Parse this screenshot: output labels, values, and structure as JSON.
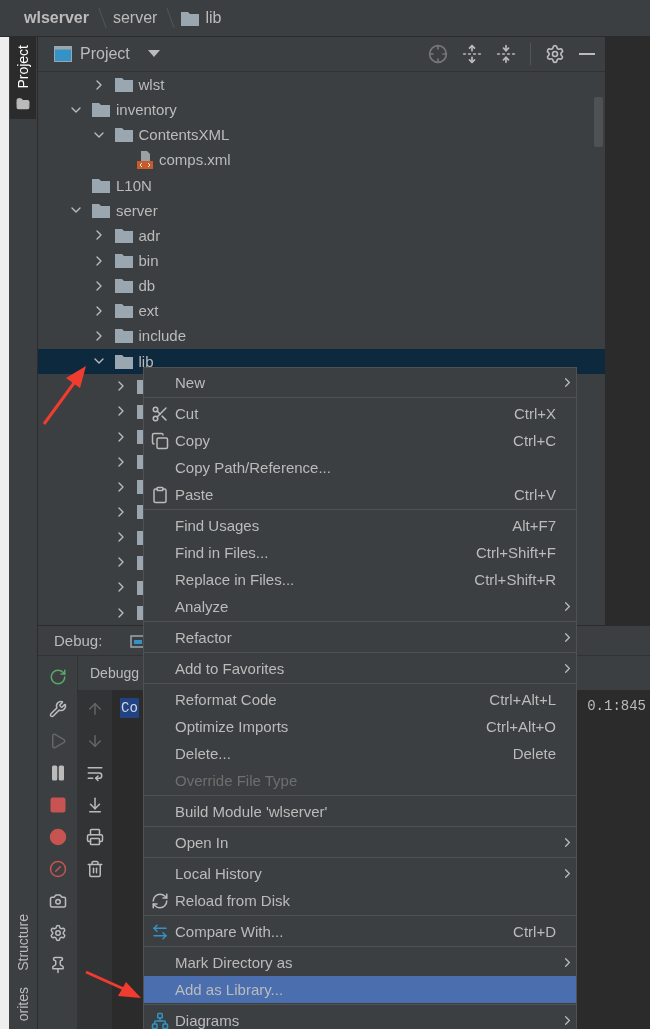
{
  "breadcrumb": [
    "wlserver",
    "server",
    "lib"
  ],
  "side_tabs": {
    "top": "Project",
    "bottom": [
      "Structure",
      "orites"
    ]
  },
  "project_panel": {
    "title": "Project"
  },
  "tree": {
    "scrolled_rows": [
      {
        "name": "wlst",
        "expanded": false,
        "selected": false
      }
    ],
    "items": [
      {
        "name": "inventory",
        "expanded": true,
        "selected": false,
        "children": [
          {
            "name": "ContentsXML",
            "expanded": true,
            "selected": false,
            "children": [
              {
                "name": "comps.xml",
                "kind": "file",
                "selected": false
              }
            ]
          }
        ]
      },
      {
        "name": "L10N",
        "selected": false
      },
      {
        "name": "server",
        "expanded": true,
        "selected": false,
        "children": [
          {
            "name": "adr",
            "expanded": false,
            "selected": false
          },
          {
            "name": "bin",
            "expanded": false,
            "selected": false
          },
          {
            "name": "db",
            "expanded": false,
            "selected": false
          },
          {
            "name": "ext",
            "expanded": false,
            "selected": false
          },
          {
            "name": "include",
            "expanded": false,
            "selected": false
          },
          {
            "name": "lib",
            "expanded": true,
            "selected": true
          }
        ]
      }
    ]
  },
  "debug": {
    "label": "Debug:",
    "tab": "Debugg",
    "console_highlight": "Co",
    "console_text": "0.1:845"
  },
  "context_menu": [
    [
      {
        "label": "New",
        "submenu": true
      }
    ],
    [
      {
        "label": "Cut",
        "shortcut": "Ctrl+X"
      },
      {
        "label": "Copy",
        "shortcut": "Ctrl+C"
      },
      {
        "label": "Copy Path/Reference..."
      },
      {
        "label": "Paste",
        "shortcut": "Ctrl+V"
      }
    ],
    [
      {
        "label": "Find Usages",
        "shortcut": "Alt+F7"
      },
      {
        "label": "Find in Files...",
        "shortcut": "Ctrl+Shift+F"
      },
      {
        "label": "Replace in Files...",
        "shortcut": "Ctrl+Shift+R"
      },
      {
        "label": "Analyze",
        "submenu": true
      }
    ],
    [
      {
        "label": "Refactor",
        "submenu": true
      }
    ],
    [
      {
        "label": "Add to Favorites",
        "submenu": true
      }
    ],
    [
      {
        "label": "Reformat Code",
        "shortcut": "Ctrl+Alt+L"
      },
      {
        "label": "Optimize Imports",
        "shortcut": "Ctrl+Alt+O"
      },
      {
        "label": "Delete...",
        "shortcut": "Delete"
      },
      {
        "label": "Override File Type",
        "disabled": true
      }
    ],
    [
      {
        "label": "Build Module 'wlserver'"
      }
    ],
    [
      {
        "label": "Open In",
        "submenu": true
      }
    ],
    [
      {
        "label": "Local History",
        "submenu": true
      },
      {
        "label": "Reload from Disk"
      }
    ],
    [
      {
        "label": "Compare With...",
        "shortcut": "Ctrl+D"
      }
    ],
    [
      {
        "label": "Mark Directory as",
        "submenu": true,
        "selected": false
      },
      {
        "label": "Add as Library...",
        "selected": true
      }
    ],
    [
      {
        "label": "Diagrams",
        "submenu": true
      }
    ]
  ]
}
